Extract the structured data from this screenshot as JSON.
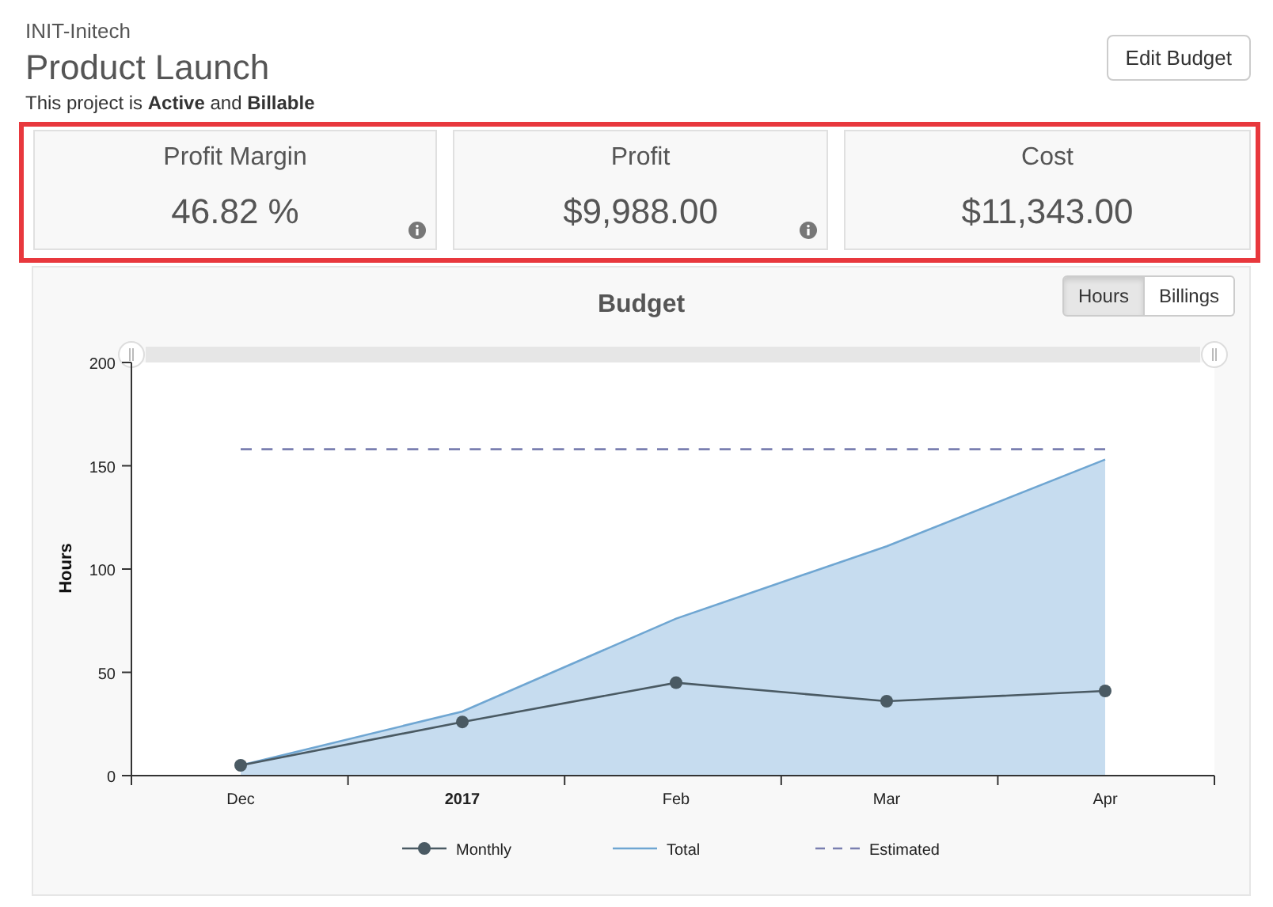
{
  "header": {
    "client": "INIT-Initech",
    "title": "Product Launch",
    "status_line": "This project is **Active** and **Billable**",
    "edit_button": "Edit Budget"
  },
  "stats": [
    {
      "label": "Profit Margin",
      "value": "46.82 %",
      "info": true
    },
    {
      "label": "Profit",
      "value": "$9,988.00",
      "info": true
    },
    {
      "label": "Cost",
      "value": "$11,343.00",
      "info": false
    }
  ],
  "chart_panel": {
    "title": "Budget",
    "toggles": [
      {
        "label": "Hours",
        "selected": true
      },
      {
        "label": "Billings",
        "selected": false
      }
    ],
    "chart_data": {
      "type": "line",
      "legend": true,
      "ylabel": "Hours",
      "categories": [
        "Dec",
        "2017",
        "Feb",
        "Mar",
        "Apr"
      ],
      "ylim": [
        0,
        200
      ],
      "yticks": [
        0,
        50,
        100,
        150,
        200
      ],
      "series": [
        {
          "name": "Monthly",
          "marker": "circle",
          "color": "#4a5a63",
          "values": [
            5,
            26,
            45,
            36,
            41
          ]
        },
        {
          "name": "Total",
          "type": "area",
          "color": "#6fa6d2",
          "values": [
            5,
            31,
            76,
            111,
            153
          ]
        },
        {
          "name": "Estimated",
          "type": "line",
          "line_style": "dashed",
          "color": "#7a7fb0",
          "values": [
            158,
            158,
            158,
            158,
            158
          ]
        }
      ]
    }
  }
}
